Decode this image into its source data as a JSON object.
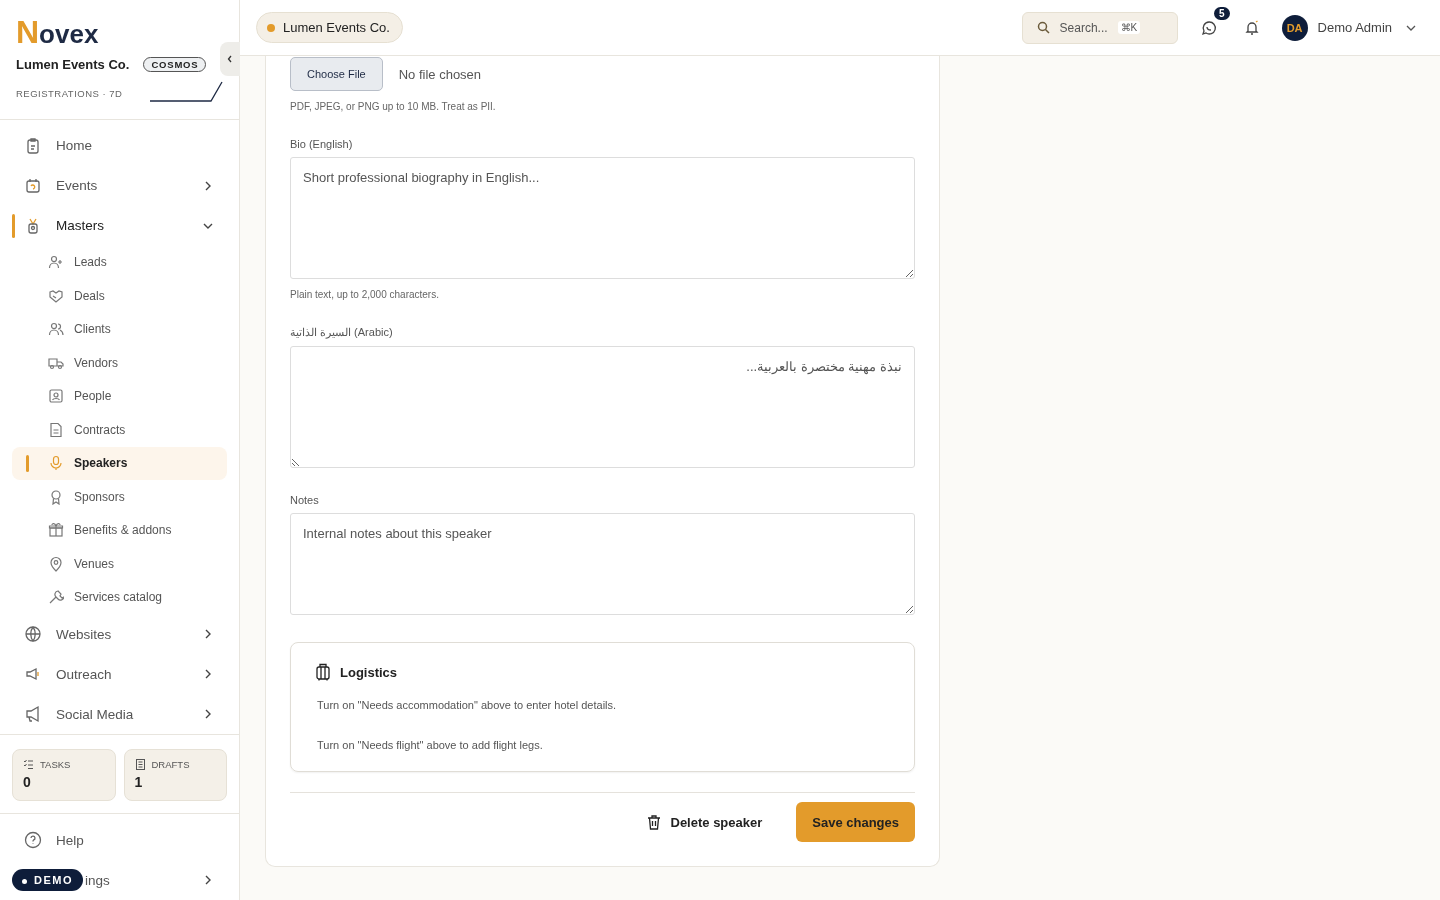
{
  "brand": {
    "logo_initial": "N",
    "logo_rest": "ovex"
  },
  "workspace": {
    "name": "Lumen Events Co.",
    "plan": "COSMOS",
    "metric_label": "REGISTRATIONS · 7D"
  },
  "sidebar": {
    "items": [
      {
        "label": "Home",
        "kind": "link",
        "selected": false
      },
      {
        "label": "Events",
        "kind": "group",
        "selected": false,
        "expanded": false
      },
      {
        "label": "Masters",
        "kind": "group",
        "selected": true,
        "expanded": true,
        "children": [
          {
            "label": "Leads",
            "selected": false
          },
          {
            "label": "Deals",
            "selected": false
          },
          {
            "label": "Clients",
            "selected": false
          },
          {
            "label": "Vendors",
            "selected": false
          },
          {
            "label": "People",
            "selected": false
          },
          {
            "label": "Contracts",
            "selected": false
          },
          {
            "label": "Speakers",
            "selected": true
          },
          {
            "label": "Sponsors",
            "selected": false
          },
          {
            "label": "Benefits & addons",
            "selected": false
          },
          {
            "label": "Venues",
            "selected": false
          },
          {
            "label": "Services catalog",
            "selected": false
          }
        ]
      },
      {
        "label": "Websites",
        "kind": "group",
        "selected": false,
        "expanded": false
      },
      {
        "label": "Outreach",
        "kind": "group",
        "selected": false,
        "expanded": false
      },
      {
        "label": "Social Media",
        "kind": "group",
        "selected": false,
        "expanded": false
      }
    ],
    "stats": [
      {
        "label": "TASKS",
        "value": "0"
      },
      {
        "label": "DRAFTS",
        "value": "1"
      }
    ],
    "footer": [
      {
        "label": "Help",
        "kind": "link"
      },
      {
        "label": "ings",
        "kind": "group",
        "expanded": false
      }
    ],
    "demo_badge": "DEMO"
  },
  "topbar": {
    "workspace": "Lumen Events Co.",
    "search": {
      "placeholder": "Search...",
      "shortcut": "⌘K"
    },
    "messages_count": "5",
    "user": {
      "initials": "DA",
      "name": "Demo Admin"
    }
  },
  "form": {
    "file": {
      "button": "Choose File",
      "status": "No file chosen",
      "hint": "PDF, JPEG, or PNG up to 10 MB. Treat as PII."
    },
    "fields": [
      {
        "label": "Bio (English)",
        "placeholder": "Short professional biography in English...",
        "hint": "Plain text, up to 2,000 characters.",
        "rtl": false,
        "kind": "long"
      },
      {
        "label": "السيرة الذاتية (Arabic)",
        "placeholder": "نبذة مهنية مختصرة بالعربية...",
        "rtl": true,
        "kind": "long"
      },
      {
        "label": "Notes",
        "placeholder": "Internal notes about this speaker",
        "rtl": false,
        "kind": "short"
      }
    ],
    "logistics": {
      "title": "Logistics",
      "notes": [
        "Turn on \"Needs accommodation\" above to enter hotel details.",
        "Turn on \"Needs flight\" above to add flight legs."
      ]
    },
    "actions": {
      "delete": "Delete speaker",
      "save": "Save changes"
    }
  }
}
